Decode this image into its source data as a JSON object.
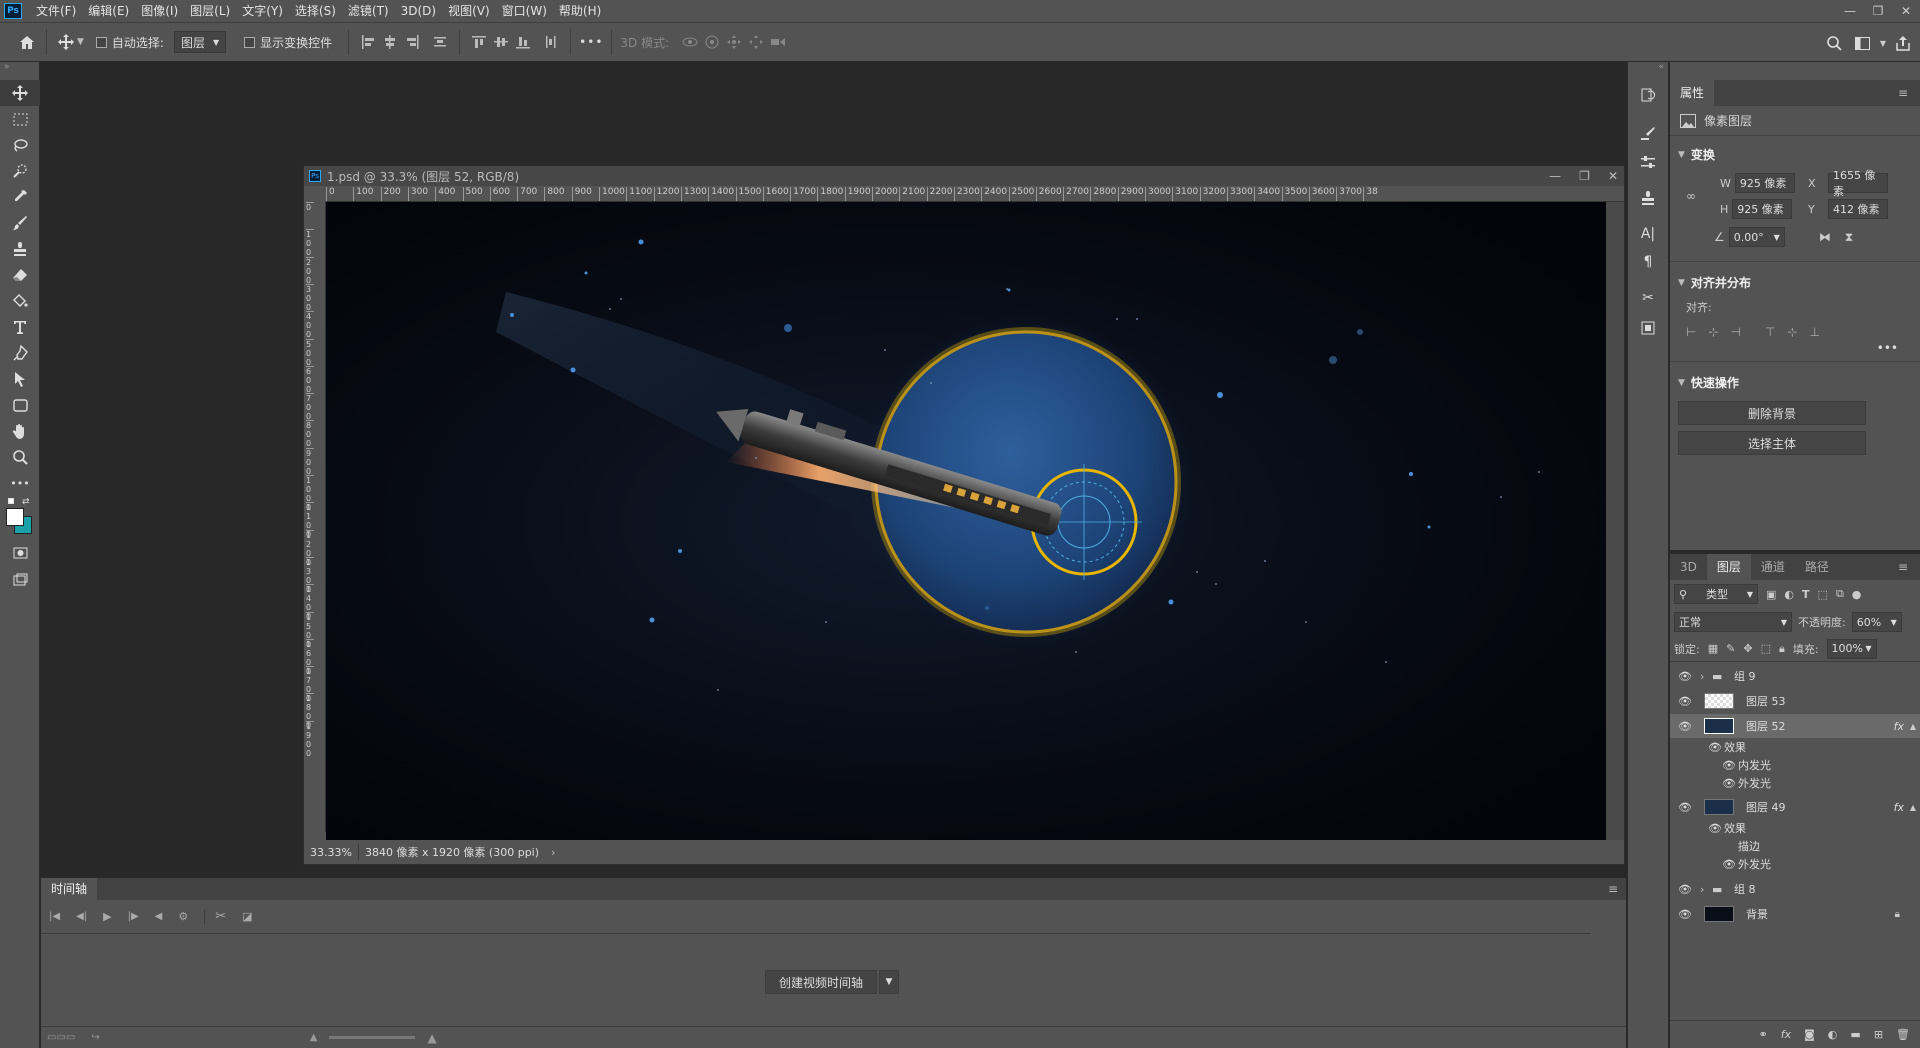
{
  "menubar": {
    "logo": "Ps",
    "items": [
      "文件(F)",
      "编辑(E)",
      "图像(I)",
      "图层(L)",
      "文字(Y)",
      "选择(S)",
      "滤镜(T)",
      "3D(D)",
      "视图(V)",
      "窗口(W)",
      "帮助(H)"
    ],
    "window_controls": [
      "—",
      "❐",
      "✕"
    ]
  },
  "options": {
    "auto_select_label": "自动选择:",
    "auto_select_value": "图层",
    "show_transform_label": "显示变换控件",
    "more": "•••",
    "mode3d_label": "3D 模式:"
  },
  "document": {
    "title": "1.psd @ 33.3% (图层 52, RGB/8)",
    "zoom": "33.33%",
    "size_info": "3840 像素 x 1920 像素 (300 ppi)",
    "ruler_h": [
      "0",
      "100",
      "200",
      "300",
      "400",
      "500",
      "600",
      "700",
      "800",
      "900",
      "1000",
      "1100",
      "1200",
      "1300",
      "1400",
      "1500",
      "1600",
      "1700",
      "1800",
      "1900",
      "2000",
      "2100",
      "2200",
      "2300",
      "2400",
      "2500",
      "2600",
      "2700",
      "2800",
      "2900",
      "3000",
      "3100",
      "3200",
      "3300",
      "3400",
      "3500",
      "3600",
      "3700",
      "38"
    ],
    "ruler_v": [
      "0",
      "100",
      "200",
      "300",
      "400",
      "500",
      "600",
      "700",
      "800",
      "900",
      "1000",
      "1100",
      "1200",
      "1300",
      "1400",
      "1500",
      "1600",
      "1700",
      "1800",
      "1900"
    ]
  },
  "timeline": {
    "tab": "时间轴",
    "create_button": "创建视频时间轴"
  },
  "properties": {
    "tab": "属性",
    "layer_type": "像素图层",
    "transform_title": "变换",
    "w_label": "W",
    "w": "925 像素",
    "x_label": "X",
    "x": "1655 像素",
    "h_label": "H",
    "h": "925 像素",
    "y_label": "Y",
    "y": "412 像素",
    "angle": "0.00°",
    "align_title": "对齐并分布",
    "align_label": "对齐:",
    "quick_title": "快速操作",
    "remove_bg": "删除背景",
    "select_subject": "选择主体"
  },
  "layers_panel": {
    "tabs": [
      "3D",
      "图层",
      "通道",
      "路径"
    ],
    "filter_kind": "类型",
    "blend_mode": "正常",
    "opacity_label": "不透明度:",
    "opacity": "60%",
    "lock_label": "锁定:",
    "fill_label": "填充:",
    "fill": "100%",
    "rows": [
      {
        "name": "组 9",
        "kind": "group"
      },
      {
        "name": "图层 53",
        "kind": "layer"
      },
      {
        "name": "图层 52",
        "kind": "layer",
        "fx": "fx",
        "selected": true
      },
      {
        "name": "效果",
        "kind": "effects"
      },
      {
        "name": "内发光",
        "kind": "effect"
      },
      {
        "name": "外发光",
        "kind": "effect"
      },
      {
        "name": "图层 49",
        "kind": "layer",
        "fx": "fx"
      },
      {
        "name": "效果",
        "kind": "effects"
      },
      {
        "name": "描边",
        "kind": "effect"
      },
      {
        "name": "外发光",
        "kind": "effect"
      },
      {
        "name": "组 8",
        "kind": "group"
      },
      {
        "name": "背景",
        "kind": "background"
      }
    ]
  },
  "colors": {
    "panel": "#535353",
    "dark": "#282828",
    "accent_ring": "#e8b500",
    "planet": "#1d4478"
  }
}
